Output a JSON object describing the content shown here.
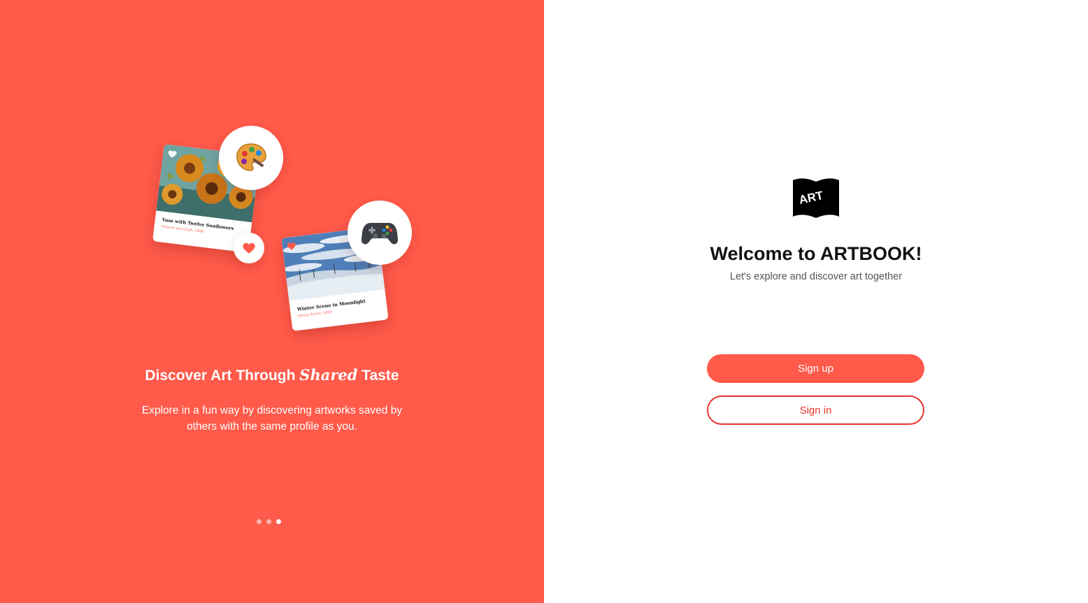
{
  "theme": {
    "accent": "#FF5A4A",
    "accent_text": "#E8332A",
    "background": "#FFFFFF"
  },
  "onboarding": {
    "cards": [
      {
        "title": "Vase with Twelve Sunflowers",
        "artist": "Vincent van Gogh, 1888",
        "icon": "heart-icon"
      },
      {
        "title": "Winter Scene in Moonlight",
        "artist": "Henry Farrer, 1869",
        "icon": "heart-icon"
      }
    ],
    "badges": [
      "palette-icon",
      "gamepad-icon",
      "heart-icon"
    ],
    "headline_before": "Discover Art Through",
    "headline_emphasis": "Shared",
    "headline_after": "Taste",
    "description": "Explore in a fun way by discovering artworks saved by others with the same profile as you.",
    "pagination": {
      "total": 3,
      "active": 3
    }
  },
  "auth": {
    "logo_text": "ART",
    "welcome_title": "Welcome to ARTBOOK!",
    "tagline": "Let's explore and discover art together",
    "signup_label": "Sign up",
    "signin_label": "Sign in"
  }
}
